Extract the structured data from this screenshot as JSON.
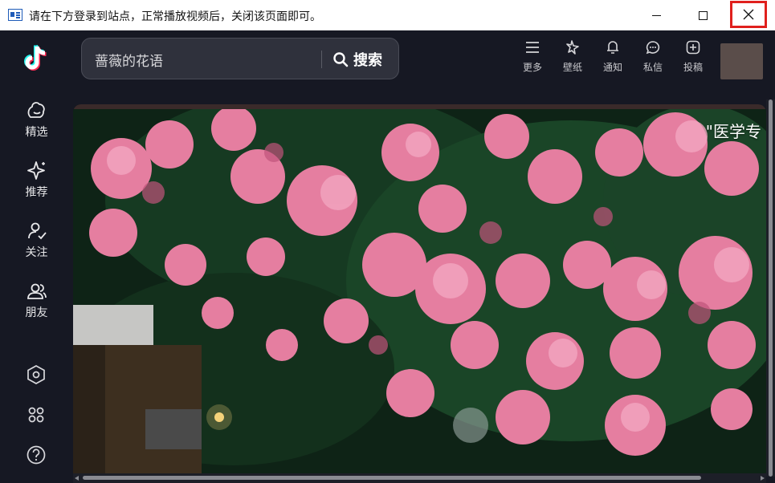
{
  "window": {
    "title": "请在下方登录到站点，正常播放视频后，关闭该页面即可。",
    "buttons": {
      "minimize": "minimize-icon",
      "maximize": "maximize-icon",
      "close": "close-icon"
    },
    "close_highlight_color": "#e0201d"
  },
  "sidebar": {
    "logo": "tiktok-logo",
    "items": [
      {
        "label": "精选",
        "icon": "featured-icon"
      },
      {
        "label": "推荐",
        "icon": "sparkle-icon"
      },
      {
        "label": "关注",
        "icon": "follow-icon"
      },
      {
        "label": "朋友",
        "icon": "friends-icon"
      }
    ],
    "bottom_icons": [
      "hexagon-settings-icon",
      "apps-grid-icon",
      "help-icon"
    ]
  },
  "header": {
    "search": {
      "value": "蔷薇的花语",
      "button_label": "搜索"
    },
    "actions": [
      {
        "label": "更多",
        "icon": "menu-icon"
      },
      {
        "label": "壁纸",
        "icon": "wallpaper-icon"
      },
      {
        "label": "通知",
        "icon": "bell-icon"
      },
      {
        "label": "私信",
        "icon": "message-icon"
      },
      {
        "label": "投稿",
        "icon": "upload-icon"
      }
    ]
  },
  "video": {
    "overlay_text": "\"医学专"
  },
  "colors": {
    "app_bg": "#161823",
    "search_bg": "#2f313c",
    "accent_cyan": "#25f4ee",
    "accent_red": "#fe2c55"
  }
}
